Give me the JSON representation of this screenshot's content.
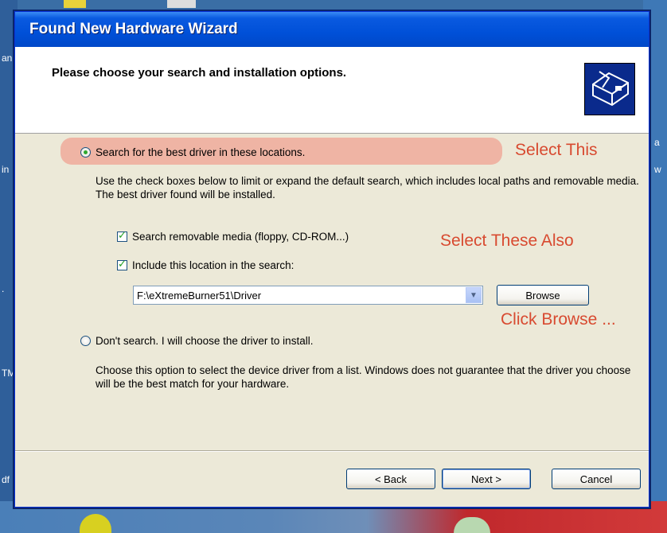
{
  "desktop": {
    "left_labels": [
      "an",
      "in",
      ".",
      "TM",
      "df"
    ],
    "right_labels": [
      "a",
      "w"
    ]
  },
  "window": {
    "title": "Found New Hardware Wizard",
    "header_title": "Please choose your search and installation options.",
    "header_icon": "hardware-wizard-icon"
  },
  "options": {
    "search_label": "Search for the best driver in these locations.",
    "search_selected": true,
    "search_desc": "Use the check boxes below to limit or expand the default search, which includes local paths and removable media. The best driver found will be installed.",
    "removable_label": "Search removable media (floppy, CD-ROM...)",
    "removable_checked": true,
    "include_label": "Include this location in the search:",
    "include_checked": true,
    "path_value": "F:\\eXtremeBurner51\\Driver",
    "browse_label": "Browse",
    "dont_search_label": "Don't search. I will choose the driver to install.",
    "dont_search_selected": false,
    "dont_search_desc": "Choose this option to select the device driver from a list.  Windows does not guarantee that the driver you choose will be the best match for your hardware."
  },
  "annotations": {
    "select_this": "Select This",
    "select_these_also": "Select These Also",
    "click_browse": "Click Browse ..."
  },
  "buttons": {
    "back": "< Back",
    "next": "Next >",
    "cancel": "Cancel"
  },
  "colors": {
    "highlight": "#efb4a4",
    "annotation": "#d84a30",
    "titlebar": "#0050d8"
  }
}
